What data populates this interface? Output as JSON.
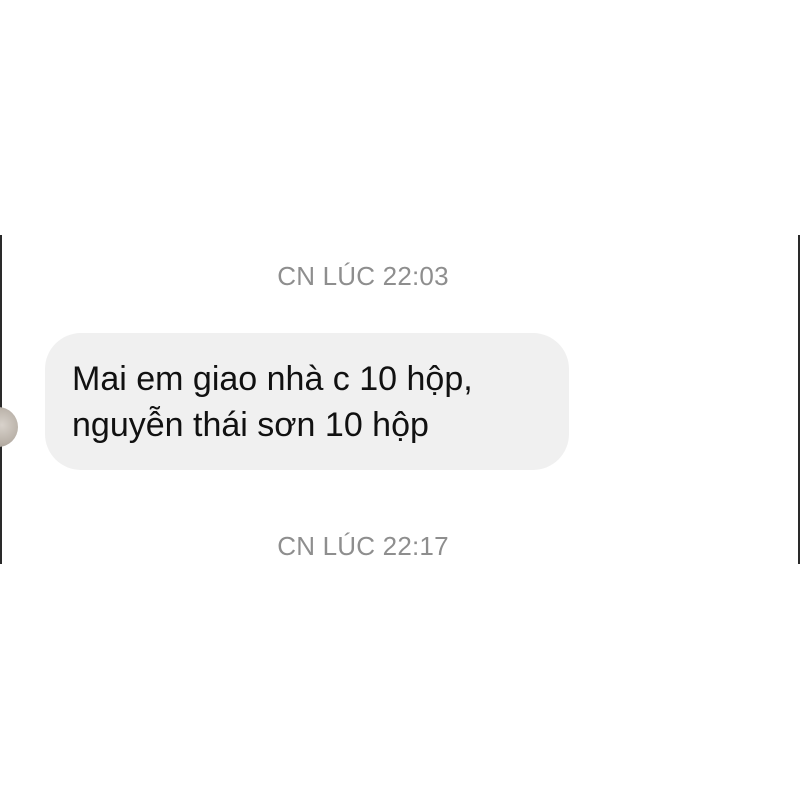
{
  "conversation": {
    "timestamp_1": "CN LÚC 22:03",
    "message": {
      "line_1": "Mai em giao nhà c 10 hộp,",
      "line_2": "nguyễn thái sơn 10 hộp"
    },
    "timestamp_2": "CN LÚC 22:17"
  },
  "colors": {
    "bubble_background": "#f0f0f0",
    "timestamp_text": "#8e8e8e",
    "message_text": "#111111"
  }
}
